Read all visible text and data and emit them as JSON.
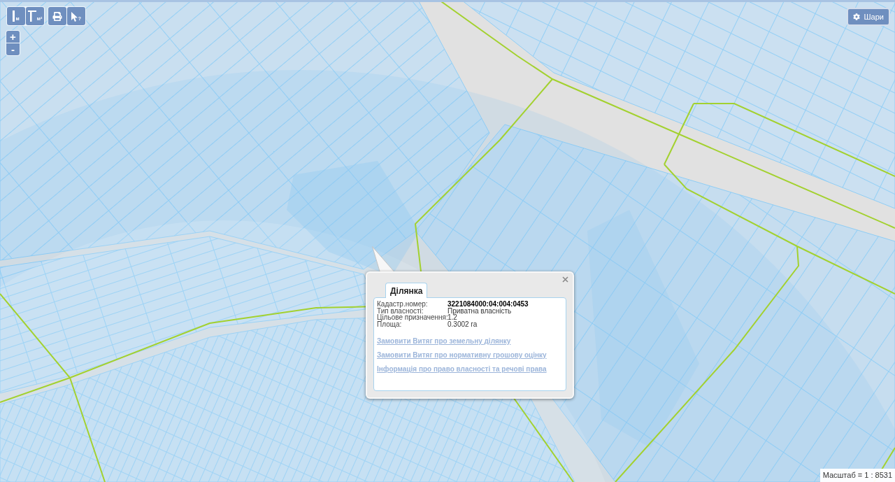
{
  "toolbar": {
    "tools": [
      {
        "kind": "measure-distance",
        "text": "м"
      },
      {
        "kind": "measure-area",
        "text": "м²"
      },
      {
        "kind": "print"
      },
      {
        "kind": "identify",
        "text": "?"
      }
    ]
  },
  "zoom": {
    "zoom_in": "+",
    "zoom_out": "-"
  },
  "layers_button": {
    "label": "Шари"
  },
  "popup": {
    "tabs": [
      {
        "label": "Ділянка",
        "selected": true
      }
    ],
    "fields": [
      {
        "label": "Кадастр.номер:",
        "value": "3221084000:04:004:0453",
        "emphasized": true
      },
      {
        "label": "Тип власності:",
        "value": "Приватна власність",
        "emphasized": false
      },
      {
        "label": "Цільове призначення:",
        "value": "1.2",
        "emphasized": false
      },
      {
        "label": "Площа:",
        "value": "0.3002 га",
        "emphasized": false
      }
    ],
    "links": [
      "Замовити Витяг про земельну ділянку",
      "Замовити Витяг про нормативну грошову оцінку",
      "Інформація про право власності та речові права"
    ]
  },
  "scale": {
    "text": "Масштаб = 1 : 8531"
  }
}
